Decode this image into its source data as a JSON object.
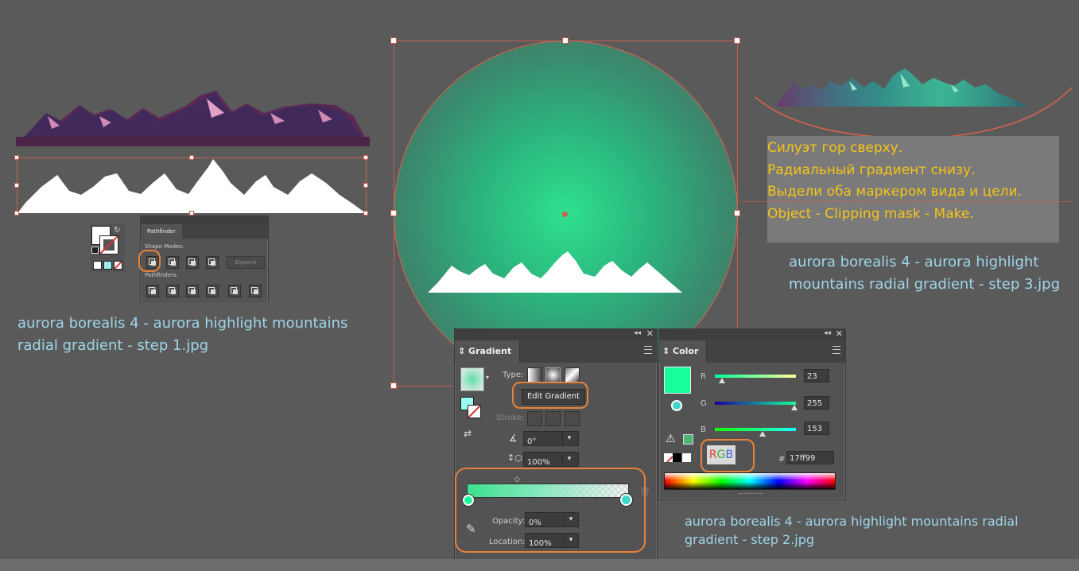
{
  "captions": {
    "step1": [
      "aurora borealis 4 - aurora highlight mountains",
      "radial gradient - step 1.jpg"
    ],
    "step2": [
      "aurora borealis 4 - aurora highlight mountains radial",
      "gradient - step 2.jpg"
    ],
    "step3": [
      "aurora borealis 4 - aurora highlight",
      "mountains radial gradient - step 3.jpg"
    ]
  },
  "note": {
    "lines": [
      "Силуэт гор сверху.",
      "Радиальный градиент снизу.",
      "Выдели оба маркером вида и цели.",
      "Object - Clipping mask - Make."
    ]
  },
  "pathfinder": {
    "tab": "Pathfinder",
    "shape_modes_label": "Shape Modes:",
    "pathfinders_label": "Pathfinders:",
    "expand_label": "Expand"
  },
  "gradient_panel": {
    "tab": "Gradient",
    "type_label": "Type:",
    "edit_button": "Edit Gradient",
    "stroke_label": "Stroke:",
    "angle_value": "0°",
    "aspect_value": "100%",
    "opacity_label": "Opacity:",
    "opacity_value": "0%",
    "location_label": "Location:",
    "location_value": "100%"
  },
  "color_panel": {
    "tab": "Color",
    "r_label": "R",
    "r_value": "23",
    "r_level": 0.09,
    "g_label": "G",
    "g_value": "255",
    "g_level": 1.0,
    "b_label": "B",
    "b_value": "153",
    "b_level": 0.6,
    "mode_label": [
      "R",
      "G",
      "B"
    ],
    "hex_label": "#",
    "hex_value": "17ff99",
    "swatch_color": "#17ff99"
  },
  "colors": {
    "accent_orange": "#e8823a",
    "caption_blue": "#9fd6ea",
    "note_yellow": "#f5c518",
    "selection_red": "#c9604f"
  }
}
